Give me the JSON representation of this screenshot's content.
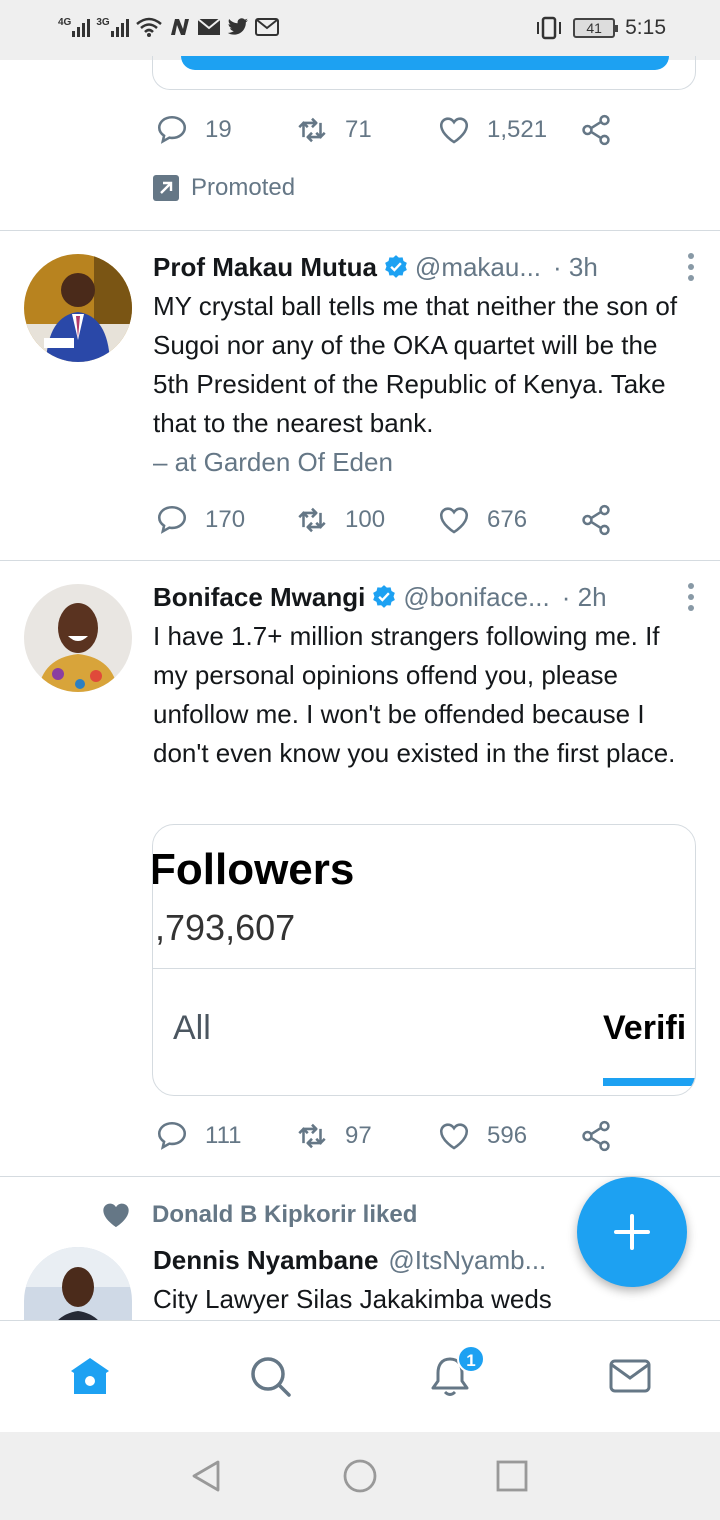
{
  "status_bar": {
    "net1": "4G",
    "net2": "3G",
    "battery": "41",
    "time": "5:15",
    "icons": [
      "wifi-icon",
      "n-icon",
      "mail-icon",
      "twitter-icon",
      "gmail-icon",
      "vibrate-icon"
    ]
  },
  "promo_tweet": {
    "replies": "19",
    "retweets": "71",
    "likes": "1,521",
    "promoted_label": "Promoted"
  },
  "tweets": [
    {
      "name": "Prof Makau Mutua",
      "handle": "@makau...",
      "time": "· 3h",
      "text": "MY crystal ball tells me that neither the son of Sugoi nor any of the OKA quartet will be the 5th President of the Republic of Kenya.  Take that to the nearest bank.",
      "location": "– at Garden Of Eden",
      "replies": "170",
      "retweets": "100",
      "likes": "676"
    },
    {
      "name": "Boniface Mwangi",
      "handle": "@boniface...",
      "time": "· 2h",
      "text": "I have 1.7+ million strangers following me. If my personal opinions offend you, please unfollow me. I won't be offended because I don't even know you existed in the first place.",
      "replies": "111",
      "retweets": "97",
      "likes": "596",
      "embed": {
        "title": "Followers",
        "count": ",793,607",
        "tab_all": "All",
        "tab_verified": "Verifi"
      }
    },
    {
      "liked_by": "Donald B Kipkorir liked",
      "name": "Dennis Nyambane",
      "handle": "@ItsNyamb...",
      "text": "City Lawyer Silas Jakakimba weds"
    }
  ],
  "bottom_nav": {
    "notification_badge": "1",
    "active": "home"
  },
  "colors": {
    "accent": "#1da1f2",
    "text_secondary": "#657786"
  }
}
